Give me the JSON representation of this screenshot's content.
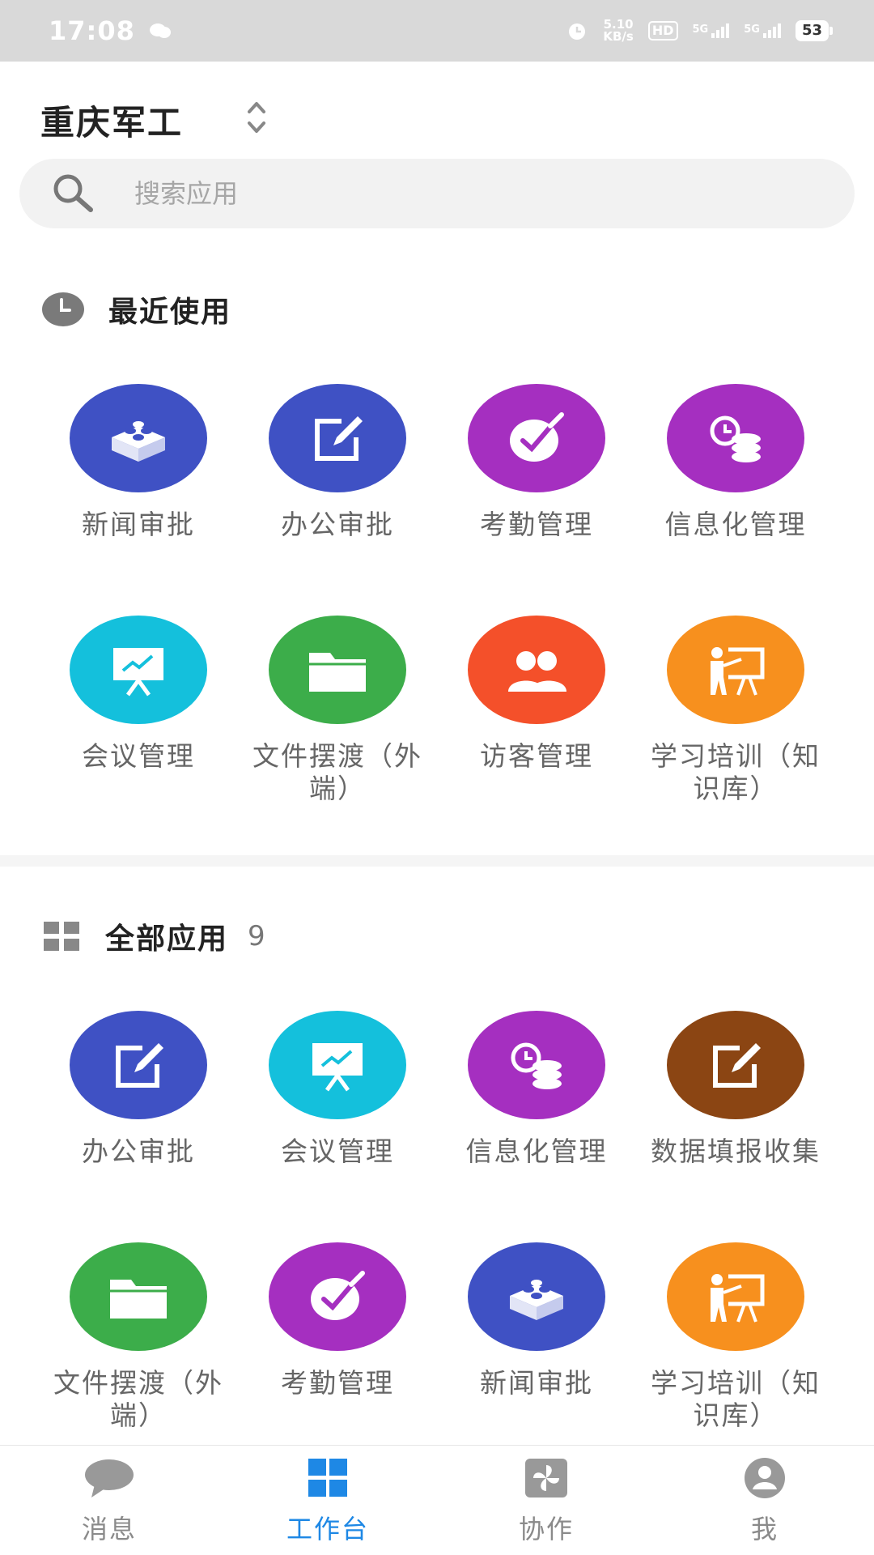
{
  "status_bar": {
    "time": "17:08",
    "net_speed_value": "5.10",
    "net_speed_unit": "KB/s",
    "hd_label": "HD",
    "signal_1_label": "5G",
    "signal_2_label": "5G",
    "battery": "53"
  },
  "header": {
    "org_name": "重庆军工"
  },
  "search": {
    "placeholder": "搜索应用"
  },
  "recent": {
    "title": "最近使用",
    "apps": [
      {
        "label": "新闻审批",
        "color": "#3f51c4",
        "icon": "lego-block-icon"
      },
      {
        "label": "办公审批",
        "color": "#3f51c4",
        "icon": "edit-icon"
      },
      {
        "label": "考勤管理",
        "color": "#a52fc0",
        "icon": "check-circle-icon"
      },
      {
        "label": "信息化管理",
        "color": "#a52fc0",
        "icon": "coins-clock-icon"
      },
      {
        "label": "会议管理",
        "color": "#14c0dc",
        "icon": "presentation-icon"
      },
      {
        "label": "文件摆渡（外端）",
        "color": "#3cad4a",
        "icon": "folder-icon"
      },
      {
        "label": "访客管理",
        "color": "#f4502a",
        "icon": "people-icon"
      },
      {
        "label": "学习培训（知识库）",
        "color": "#f7901e",
        "icon": "teacher-icon"
      }
    ]
  },
  "all_apps": {
    "title": "全部应用",
    "count": "9",
    "apps": [
      {
        "label": "办公审批",
        "color": "#3f51c4",
        "icon": "edit-icon"
      },
      {
        "label": "会议管理",
        "color": "#14c0dc",
        "icon": "presentation-icon"
      },
      {
        "label": "信息化管理",
        "color": "#a52fc0",
        "icon": "coins-clock-icon"
      },
      {
        "label": "数据填报收集",
        "color": "#8b4513",
        "icon": "edit-icon"
      },
      {
        "label": "文件摆渡（外端）",
        "color": "#3cad4a",
        "icon": "folder-icon"
      },
      {
        "label": "考勤管理",
        "color": "#a52fc0",
        "icon": "check-circle-icon"
      },
      {
        "label": "新闻审批",
        "color": "#3f51c4",
        "icon": "lego-block-icon"
      },
      {
        "label": "学习培训（知识库）",
        "color": "#f7901e",
        "icon": "teacher-icon"
      }
    ]
  },
  "bottom_nav": {
    "items": [
      {
        "label": "消息",
        "icon": "chat-bubble-icon"
      },
      {
        "label": "工作台",
        "icon": "grid-icon",
        "active": true
      },
      {
        "label": "协作",
        "icon": "pinwheel-icon"
      },
      {
        "label": "我",
        "icon": "user-icon"
      }
    ],
    "active_color": "#1e88e5",
    "inactive_color": "#8a8a8a"
  }
}
